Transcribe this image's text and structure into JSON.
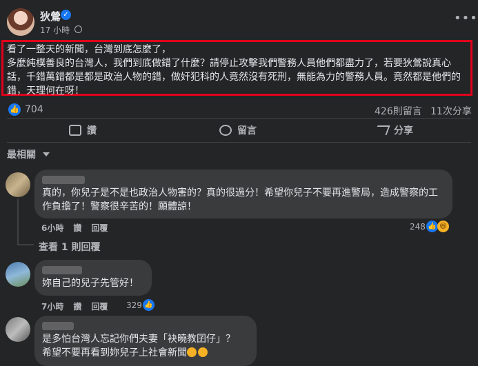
{
  "post": {
    "author": "狄鶯",
    "time": "17 小時",
    "text": "看了一整天的新聞，台灣到底怎麼了，\n多麼純樸善良的台灣人，我們到底做錯了什麼？請停止攻擊我們警務人員他們都盡力了，若要狄鶯說真心話，千錯萬錯都是都是政治人物的錯，做奸犯科的人竟然沒有死刑，無能為力的警務人員。竟然都是他們的錯，天理何在呀！",
    "likes": "704",
    "comments": "426則留言",
    "shares": "11次分享"
  },
  "actions": {
    "like": "讚",
    "comment": "留言",
    "share": "分享"
  },
  "sort_label": "最相關",
  "comments": [
    {
      "text": "真的，你兒子是不是也政治人物害的？真的很過分！希望你兒子不要再進警局，造成警察的工作負擔了！警察很辛苦的！願體諒！",
      "time": "6小時",
      "like": "讚",
      "reply": "回覆",
      "reactions": "248",
      "view_replies": "查看 1 則回覆"
    },
    {
      "text": "妳自己的兒子先管好！",
      "time": "7小時",
      "like": "讚",
      "reply": "回覆",
      "reactions": "329"
    },
    {
      "text": "是多怕台灣人忘記你們夫妻「袂曉教囝仔」？\n希望不要再看到妳兒子上社會新聞"
    }
  ]
}
